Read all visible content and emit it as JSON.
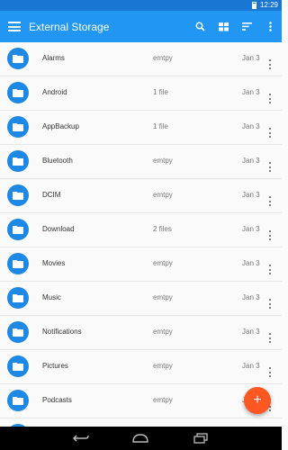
{
  "status": {
    "time": "12:29"
  },
  "appbar": {
    "title": "External Storage",
    "icons": [
      "menu-icon",
      "search-icon",
      "grid-view-icon",
      "sort-icon",
      "more-vert-icon"
    ]
  },
  "files": [
    {
      "name": "Alarms",
      "count": "emtpy",
      "date": "Jan 3"
    },
    {
      "name": "Android",
      "count": "1 file",
      "date": "Jan 3"
    },
    {
      "name": "AppBackup",
      "count": "1 file",
      "date": "Jan 3"
    },
    {
      "name": "Bluetooth",
      "count": "emtpy",
      "date": "Jan 3"
    },
    {
      "name": "DCIM",
      "count": "emtpy",
      "date": "Jan 3"
    },
    {
      "name": "Download",
      "count": "2 files",
      "date": "Jan 3"
    },
    {
      "name": "Movies",
      "count": "emtpy",
      "date": "Jan 3"
    },
    {
      "name": "Music",
      "count": "emtpy",
      "date": "Jan 3"
    },
    {
      "name": "Notifications",
      "count": "emtpy",
      "date": "Jan 3"
    },
    {
      "name": "Pictures",
      "count": "emtpy",
      "date": "Jan 3"
    },
    {
      "name": "Podcasts",
      "count": "emtpy",
      "date": "Jan 3"
    },
    {
      "name": "",
      "count": "",
      "date": ""
    }
  ],
  "fab": {
    "label": "+"
  },
  "colors": {
    "statusbar": "#1976d2",
    "appbar": "#2196f3",
    "folder": "#1e88e5",
    "fab": "#ff5722"
  }
}
